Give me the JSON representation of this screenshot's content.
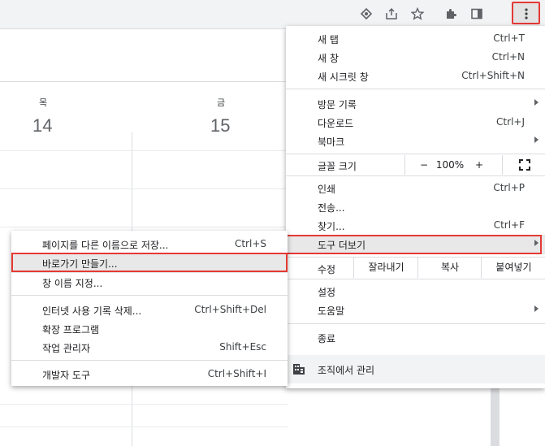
{
  "toolbar": {
    "icons": [
      "lens-icon",
      "share-icon",
      "star-icon",
      "extensions-icon",
      "side-panel-icon",
      "more-vert-icon"
    ]
  },
  "calendar": {
    "days": [
      {
        "name": "목",
        "number": "14"
      },
      {
        "name": "금",
        "number": "15"
      }
    ]
  },
  "main_menu": {
    "new_tab": {
      "label": "새 탭",
      "shortcut": "Ctrl+T"
    },
    "new_window": {
      "label": "새 창",
      "shortcut": "Ctrl+N"
    },
    "incognito": {
      "label": "새 시크릿 창",
      "shortcut": "Ctrl+Shift+N"
    },
    "history": {
      "label": "방문 기록"
    },
    "downloads": {
      "label": "다운로드",
      "shortcut": "Ctrl+J"
    },
    "bookmarks": {
      "label": "북마크"
    },
    "zoom": {
      "label": "글꼴 크기",
      "minus": "−",
      "value": "100%",
      "plus": "+"
    },
    "print": {
      "label": "인쇄",
      "shortcut": "Ctrl+P"
    },
    "cast": {
      "label": "전송..."
    },
    "find": {
      "label": "찾기...",
      "shortcut": "Ctrl+F"
    },
    "more_tools": {
      "label": "도구 더보기"
    },
    "edit": {
      "label": "수정",
      "cut": "잘라내기",
      "copy": "복사",
      "paste": "붙여넣기"
    },
    "settings": {
      "label": "설정"
    },
    "help": {
      "label": "도움말"
    },
    "exit": {
      "label": "종료"
    },
    "managed": {
      "label": "조직에서 관리"
    }
  },
  "sub_menu": {
    "save_page": {
      "label": "페이지를 다른 이름으로 저장...",
      "shortcut": "Ctrl+S"
    },
    "create_shortcut": {
      "label": "바로가기 만들기..."
    },
    "name_window": {
      "label": "창 이름 지정..."
    },
    "clear_data": {
      "label": "인터넷 사용 기록 삭제...",
      "shortcut": "Ctrl+Shift+Del"
    },
    "extensions": {
      "label": "확장 프로그램"
    },
    "task_manager": {
      "label": "작업 관리자",
      "shortcut": "Shift+Esc"
    },
    "dev_tools": {
      "label": "개발자 도구",
      "shortcut": "Ctrl+Shift+I"
    }
  },
  "colors": {
    "highlight_outline": "#e53935",
    "hover_bg": "#e8e8e8"
  }
}
